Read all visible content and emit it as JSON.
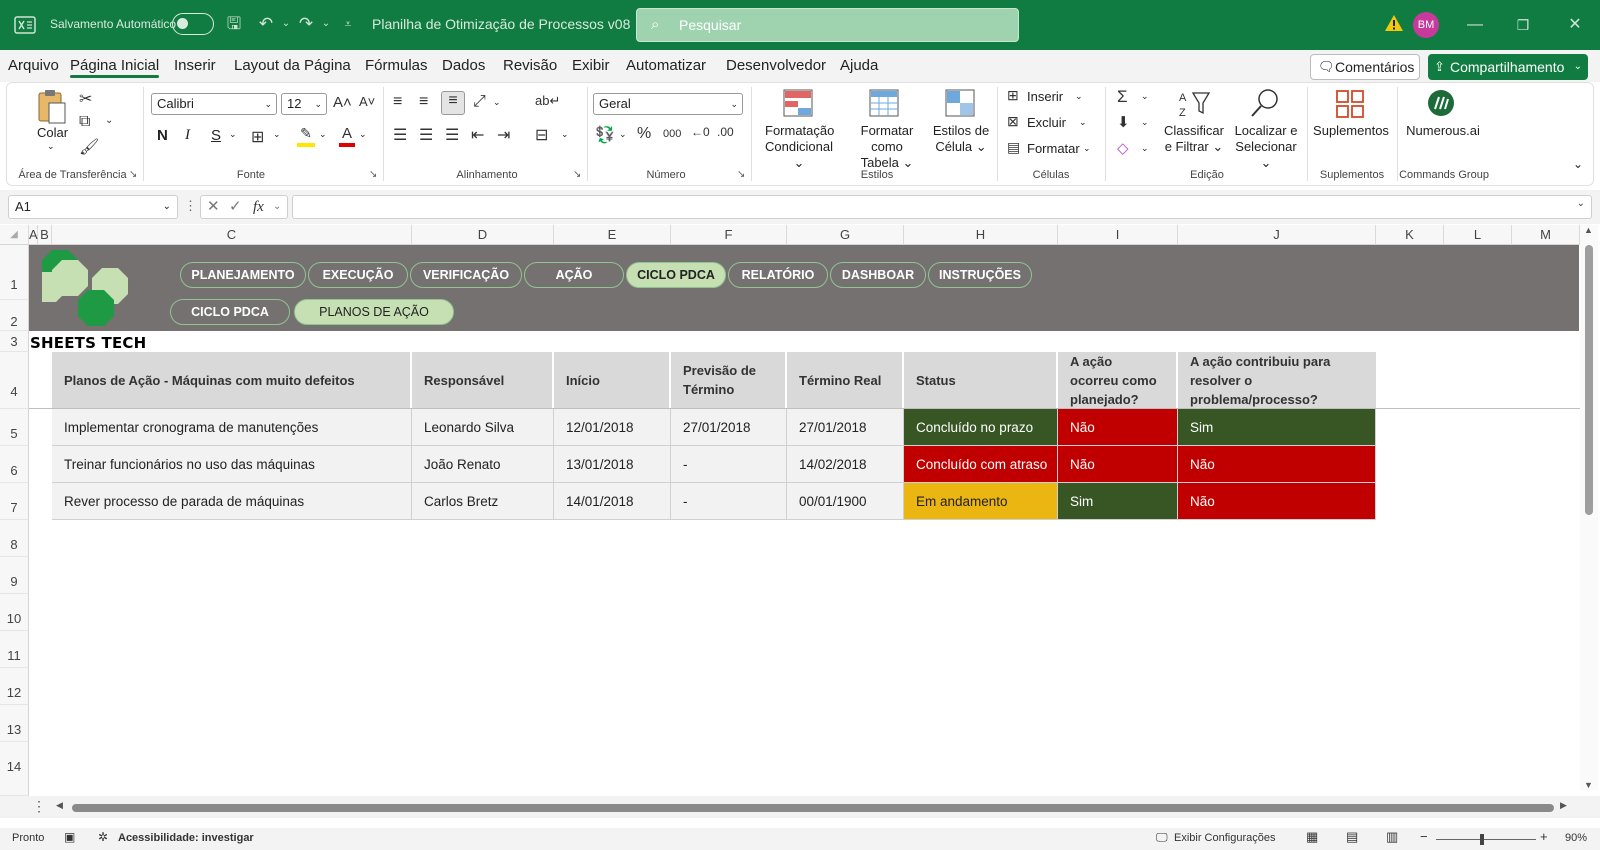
{
  "titlebar": {
    "autosave_label": "Salvamento Automático",
    "doc_title": "Planilha de Otimização de Processos v08 ⌄",
    "search_placeholder": "Pesquisar",
    "avatar_initials": "BM"
  },
  "menu": {
    "tabs": [
      "Arquivo",
      "Página Inicial",
      "Inserir",
      "Layout da Página",
      "Fórmulas",
      "Dados",
      "Revisão",
      "Exibir",
      "Automatizar",
      "Desenvolvedor",
      "Ajuda"
    ],
    "active_index": 1,
    "comments_label": "Comentários",
    "share_label": "Compartilhamento"
  },
  "ribbon": {
    "clipboard": {
      "paste": "Colar",
      "group": "Área de Transferência"
    },
    "font": {
      "name": "Calibri",
      "size": "12",
      "bold": "N",
      "italic": "I",
      "underline": "S",
      "group": "Fonte"
    },
    "alignment": {
      "group": "Alinhamento"
    },
    "number": {
      "format": "Geral",
      "group": "Número"
    },
    "styles": {
      "cond_format": [
        "Formatação",
        "Condicional ⌄"
      ],
      "format_table": [
        "Formatar como",
        "Tabela ⌄"
      ],
      "cell_styles": [
        "Estilos de",
        "Célula ⌄"
      ],
      "group": "Estilos"
    },
    "cells": {
      "insert": "Inserir",
      "delete": "Excluir",
      "format": "Formatar",
      "group": "Células"
    },
    "editing": {
      "sort": [
        "Classificar",
        "e Filtrar ⌄"
      ],
      "find": [
        "Localizar e",
        "Selecionar ⌄"
      ],
      "group": "Edição"
    },
    "addins": {
      "label": "Suplementos",
      "group": "Suplementos"
    },
    "numerous": {
      "label": "Numerous.ai",
      "group": "Commands Group"
    }
  },
  "formula_bar": {
    "name_box": "A1",
    "fx": "fx",
    "formula": ""
  },
  "columns": [
    "A",
    "B",
    "C",
    "D",
    "E",
    "F",
    "G",
    "H",
    "I",
    "J",
    "K",
    "L",
    "M"
  ],
  "rows": [
    "1",
    "2",
    "3",
    "4",
    "5",
    "6",
    "7",
    "8",
    "9",
    "10",
    "11",
    "12",
    "13",
    "14"
  ],
  "nav": {
    "top": [
      "PLANEJAMENTO",
      "EXECUÇÃO",
      "VERIFICAÇÃO",
      "AÇÃO",
      "CICLO PDCA",
      "RELATÓRIO",
      "DASHBOAR",
      "INSTRUÇÕES"
    ],
    "top_active": 4,
    "sub": [
      "CICLO PDCA",
      "PLANOS DE AÇÃO"
    ],
    "sub_active": 1
  },
  "brand": "SHEETS TECH",
  "table": {
    "headers": [
      "Planos de Ação - Máquinas com muito defeitos",
      "Responsável",
      "Início",
      "Previsão de Término",
      "Término Real",
      "Status",
      "A ação ocorreu como planejado?",
      "A ação contribuiu para resolver o problema/processo?"
    ],
    "rows": [
      [
        "Implementar cronograma de manutenções",
        "Leonardo Silva",
        "12/01/2018",
        "27/01/2018",
        "27/01/2018",
        "Concluído no prazo",
        "Não",
        "Sim"
      ],
      [
        "Treinar funcionários no uso das máquinas",
        "João Renato",
        "13/01/2018",
        "-",
        "14/02/2018",
        "Concluído com atraso",
        "Não",
        "Não"
      ],
      [
        "Rever processo de parada de máquinas",
        "Carlos Bretz",
        "14/01/2018",
        "-",
        "00/01/1900",
        "Em andamento",
        "Sim",
        "Não"
      ]
    ],
    "cell_colors": [
      [
        "",
        "",
        "",
        "",
        "",
        "green",
        "red",
        "green"
      ],
      [
        "",
        "",
        "",
        "",
        "",
        "red",
        "red",
        "red"
      ],
      [
        "",
        "",
        "",
        "",
        "",
        "yellow",
        "green",
        "red"
      ]
    ]
  },
  "statusbar": {
    "ready": "Pronto",
    "accessibility": "Acessibilidade: investigar",
    "display_settings": "Exibir Configurações",
    "zoom": "90%"
  },
  "colors": {
    "excel_green": "#107c41",
    "banner": "#757171",
    "pill_active": "#c6e0b4",
    "status_green": "#375623",
    "status_red": "#c00000",
    "status_yellow": "#ebb512"
  }
}
